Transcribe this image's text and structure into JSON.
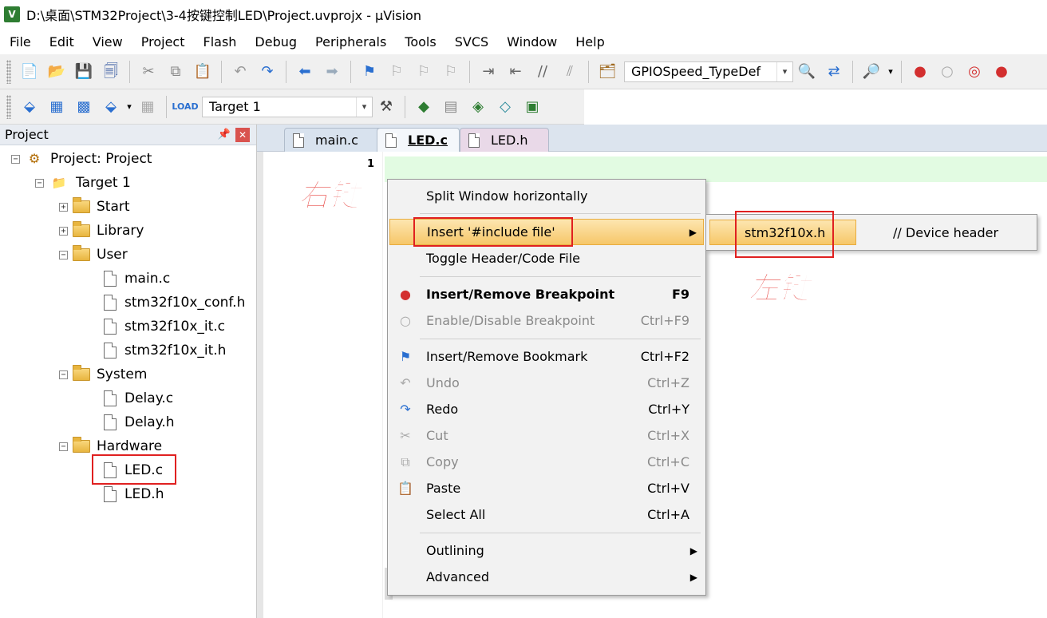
{
  "window": {
    "icon_letter": "V",
    "title": "D:\\桌面\\STM32Project\\3-4按键控制LED\\Project.uvprojx - µVision"
  },
  "menu": [
    "File",
    "Edit",
    "View",
    "Project",
    "Flash",
    "Debug",
    "Peripherals",
    "Tools",
    "SVCS",
    "Window",
    "Help"
  ],
  "toolbar1": {
    "icons": [
      "new-file-icon",
      "open-folder-icon",
      "save-icon",
      "save-all-icon",
      "cut-icon",
      "copy-icon",
      "paste-icon",
      "undo-icon",
      "redo-icon",
      "nav-back-icon",
      "nav-forward-icon",
      "bookmark-icon",
      "bookmark-prev-icon",
      "bookmark-next-icon",
      "bookmark-clear-icon",
      "indent-icon",
      "unindent-icon",
      "comment-icon",
      "uncomment-icon",
      "find-in-files-icon",
      "find-icon",
      "debug-session-icon",
      "breakpoint-icon",
      "breakpoint-disable-icon",
      "breakpoint-kill-icon"
    ],
    "find_value": "GPIOSpeed_TypeDef"
  },
  "toolbar2": {
    "icons": [
      "translate-icon",
      "build-icon",
      "rebuild-icon",
      "batch-build-icon",
      "stop-build-icon",
      "download-icon",
      "options-icon",
      "manage-components-icon",
      "select-packs-icon",
      "pack-installer-icon",
      "rte-icon"
    ],
    "target_value": "Target 1"
  },
  "project_panel": {
    "title": "Project",
    "pin": "ᵰ",
    "close": "✕",
    "tree": {
      "project": "Project: Project",
      "target": "Target 1",
      "groups": {
        "start": "Start",
        "library": "Library",
        "user": "User",
        "user_files": [
          "main.c",
          "stm32f10x_conf.h",
          "stm32f10x_it.c",
          "stm32f10x_it.h"
        ],
        "system": "System",
        "system_files": [
          "Delay.c",
          "Delay.h"
        ],
        "hardware": "Hardware",
        "hardware_files": [
          "LED.c",
          "LED.h"
        ]
      }
    }
  },
  "editor": {
    "tabs": [
      "main.c",
      "LED.c",
      "LED.h"
    ],
    "active_tab": "LED.c",
    "line_number": "1"
  },
  "annotations": {
    "right_click": "右键",
    "left_click": "左键"
  },
  "context_menu": {
    "items": [
      {
        "label": "Split Window horizontally",
        "shortcut": ""
      },
      {
        "label": "Insert '#include file'",
        "shortcut": ""
      },
      {
        "label": "Toggle Header/Code File",
        "shortcut": ""
      },
      {
        "label": "Insert/Remove Breakpoint",
        "shortcut": "F9"
      },
      {
        "label": "Enable/Disable Breakpoint",
        "shortcut": "Ctrl+F9"
      },
      {
        "label": "Insert/Remove Bookmark",
        "shortcut": "Ctrl+F2"
      },
      {
        "label": "Undo",
        "shortcut": "Ctrl+Z"
      },
      {
        "label": "Redo",
        "shortcut": "Ctrl+Y"
      },
      {
        "label": "Cut",
        "shortcut": "Ctrl+X"
      },
      {
        "label": "Copy",
        "shortcut": "Ctrl+C"
      },
      {
        "label": "Paste",
        "shortcut": "Ctrl+V"
      },
      {
        "label": "Select All",
        "shortcut": "Ctrl+A"
      },
      {
        "label": "Outlining",
        "shortcut": ""
      },
      {
        "label": "Advanced",
        "shortcut": ""
      }
    ],
    "submenu_arrow": "▶"
  },
  "submenu": {
    "file": "stm32f10x.h",
    "comment": "// Device header"
  },
  "colors": {
    "highlight_box": "#e02020",
    "annotation_text": "#e53935",
    "menu_hover": "#f6c769",
    "current_line": "#e2fbe2"
  }
}
